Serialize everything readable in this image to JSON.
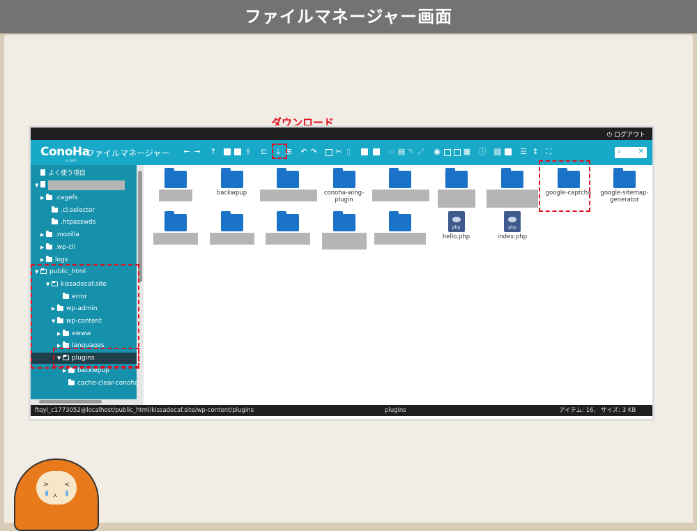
{
  "slide": {
    "title": "ファイルマネージャー画面",
    "download_callout": "ダウンロード"
  },
  "app": {
    "topbar": {
      "logout_label": "ログアウト"
    },
    "logo": "ConoHa",
    "logo_sub": "by GMO",
    "name": "ファイルマネージャー",
    "search_icon": "search-icon"
  },
  "sidebar": {
    "favorites": "よく使う項目",
    "items": [
      {
        "label": ".cagefs",
        "expandable": true
      },
      {
        "label": ".cl.selector",
        "expandable": false
      },
      {
        "label": ".htpasswds",
        "expandable": false
      },
      {
        "label": ".mozilla",
        "expandable": true
      },
      {
        "label": ".wp-cli",
        "expandable": true
      },
      {
        "label": "logs",
        "expandable": true
      },
      {
        "label": "public_html",
        "expanded": true
      },
      {
        "label": "kissadecaf.site",
        "expanded": true
      },
      {
        "label": "error"
      },
      {
        "label": "wp-admin"
      },
      {
        "label": "wp-content"
      },
      {
        "label": "ewww"
      },
      {
        "label": "languages"
      },
      {
        "label": "plugins",
        "selected": true
      },
      {
        "label": "backwpup"
      },
      {
        "label": "cache-clear-conoha"
      }
    ]
  },
  "grid": {
    "items": [
      {
        "label": "",
        "type": "folder"
      },
      {
        "label": "backwpup",
        "type": "folder"
      },
      {
        "label": "",
        "type": "folder"
      },
      {
        "label": "conoha-wing-plugin",
        "type": "folder"
      },
      {
        "label": "",
        "type": "folder"
      },
      {
        "label": "",
        "type": "folder"
      },
      {
        "label": "",
        "type": "folder"
      },
      {
        "label": "google-captcha",
        "type": "folder"
      },
      {
        "label": "google-sitemap-generator",
        "type": "folder"
      },
      {
        "label": "",
        "type": "folder"
      },
      {
        "label": "",
        "type": "folder"
      },
      {
        "label": "",
        "type": "folder"
      },
      {
        "label": "",
        "type": "folder"
      },
      {
        "label": "",
        "type": "folder"
      },
      {
        "label": "hello.php",
        "type": "php"
      },
      {
        "label": "index.php",
        "type": "php"
      }
    ],
    "php_badge": "php"
  },
  "status": {
    "path": "ftqyl_c1773052@localhost/public_html/kissadecaf.site/wp-content/plugins",
    "current": "plugins",
    "items": "アイテム: 16,",
    "size": "サイズ: 3 KB"
  }
}
